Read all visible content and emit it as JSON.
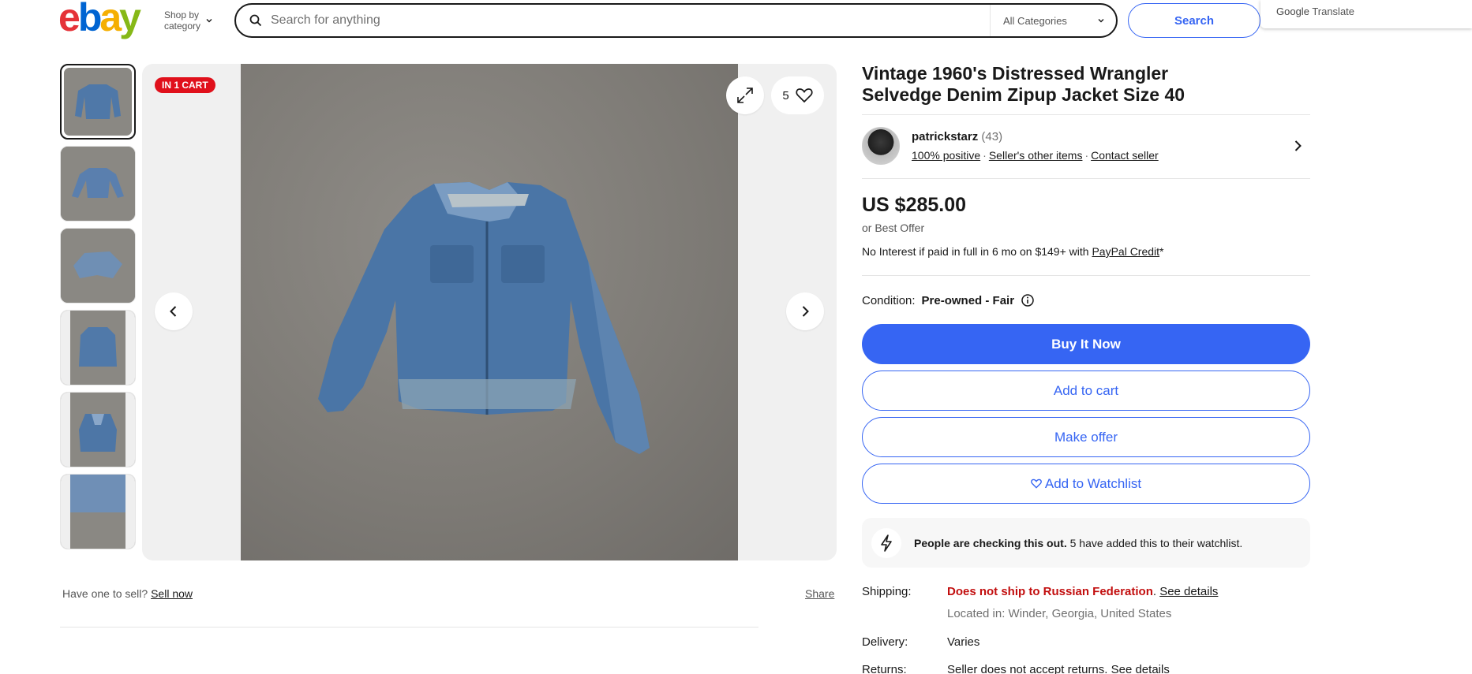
{
  "header": {
    "logo": [
      "e",
      "b",
      "a",
      "y"
    ],
    "shop_by_line1": "Shop by",
    "shop_by_line2": "category",
    "search_placeholder": "Search for anything",
    "category_select": "All Categories",
    "search_button": "Search",
    "google_translate": "Google",
    "google_translate_suffix": "Translate"
  },
  "gallery": {
    "badge": "IN 1 CART",
    "watch_count": "5",
    "thumbnail_count": 6,
    "sell_prompt": "Have one to sell?",
    "sell_link": "Sell now",
    "share": "Share"
  },
  "listing": {
    "title": "Vintage 1960's Distressed Wrangler Selvedge Denim Zipup Jacket Size 40",
    "seller_name": "patrickstarz",
    "seller_feedback": "(43)",
    "seller_positive": "100% positive",
    "seller_other_items": "Seller's other items",
    "contact_seller": "Contact seller",
    "price": "US $285.00",
    "best_offer": "or Best Offer",
    "credit_text": "No Interest if paid in full in 6 mo on $149+ with ",
    "credit_link": "PayPal Credit",
    "credit_suffix": "*",
    "condition_label": "Condition:",
    "condition_value": "Pre-owned - Fair",
    "buy_now": "Buy It Now",
    "add_to_cart": "Add to cart",
    "make_offer": "Make offer",
    "add_to_watchlist": "Add to Watchlist",
    "checking_bold": "People are checking this out.",
    "checking_rest": " 5 have added this to their watchlist.",
    "shipping_label": "Shipping:",
    "shipping_warning": "Does not ship to Russian Federation",
    "shipping_details": "See details",
    "located_in": "Located in: Winder, Georgia, United States",
    "delivery_label": "Delivery:",
    "delivery_value": "Varies",
    "returns_label": "Returns:",
    "returns_value": "Seller does not accept returns. See details"
  },
  "colors": {
    "accent": "#3665f3",
    "badge_red": "#e0101b",
    "warning_red": "#c20e0e"
  }
}
